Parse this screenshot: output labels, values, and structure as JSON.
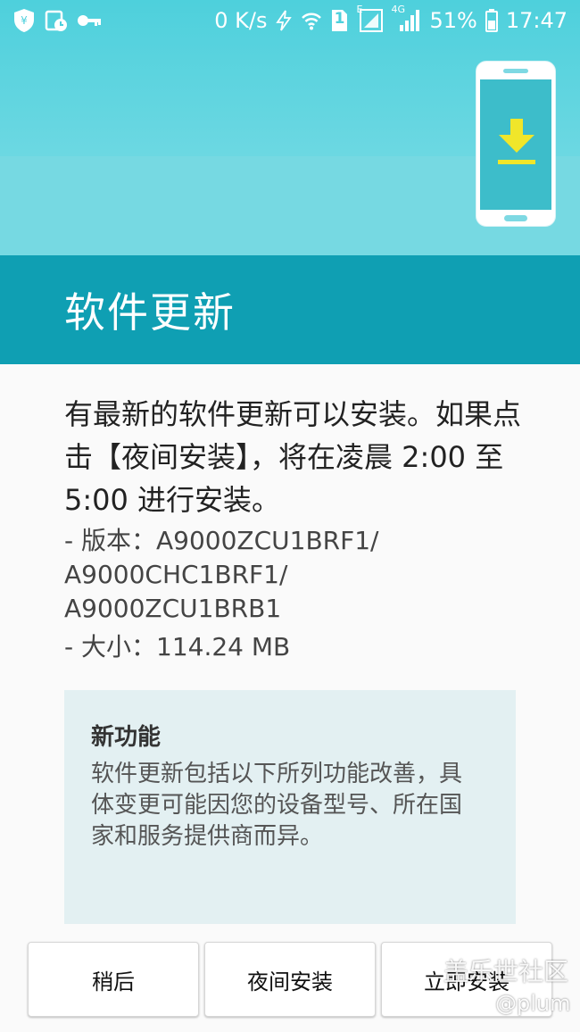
{
  "status_bar": {
    "net_speed": "0 K/s",
    "sim_slot": "1",
    "signal1_label": "E",
    "signal2_label": "4G",
    "battery": "51%",
    "time": "17:47",
    "icons": [
      "shield-yen-icon",
      "image-clock-icon",
      "key-icon",
      "data-saver-icon",
      "wifi-icon",
      "sim-icon",
      "signal-e-icon",
      "signal-4g-icon",
      "battery-icon"
    ]
  },
  "hero": {
    "icon": "phone-download-icon",
    "accent_color": "#f0e62a"
  },
  "page": {
    "title": "软件更新",
    "header_color": "#0f9fb3"
  },
  "update": {
    "description": "有最新的软件更新可以安装。如果点击【夜间安装】，将在凌晨 2:00 至 5:00 进行安装。",
    "version_line1": " - 版本：A9000ZCU1BRF1/",
    "version_line2": "A9000CHC1BRF1/",
    "version_line3": "A9000ZCU1BRB1",
    "size_line": " - 大小：114.24 MB"
  },
  "new_features": {
    "title": "新功能",
    "text": "软件更新包括以下所列功能改善，具体变更可能因您的设备型号、所在国家和服务提供商而异。"
  },
  "buttons": {
    "later": "稍后",
    "night_install": "夜间安装",
    "install_now": "立即安装"
  },
  "watermark": {
    "line1": "盖乐世社区",
    "line2": "@plum"
  }
}
